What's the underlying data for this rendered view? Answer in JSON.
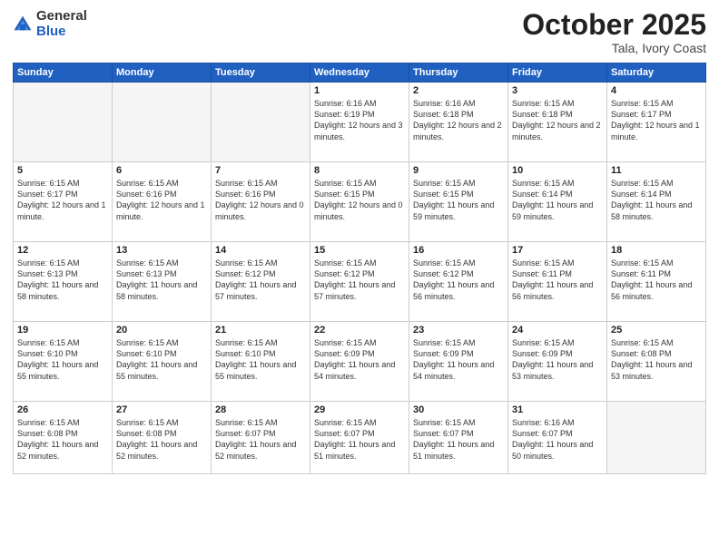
{
  "header": {
    "logo_general": "General",
    "logo_blue": "Blue",
    "month_title": "October 2025",
    "location": "Tala, Ivory Coast"
  },
  "days_of_week": [
    "Sunday",
    "Monday",
    "Tuesday",
    "Wednesday",
    "Thursday",
    "Friday",
    "Saturday"
  ],
  "weeks": [
    [
      {
        "day": "",
        "text": ""
      },
      {
        "day": "",
        "text": ""
      },
      {
        "day": "",
        "text": ""
      },
      {
        "day": "1",
        "text": "Sunrise: 6:16 AM\nSunset: 6:19 PM\nDaylight: 12 hours and 3 minutes."
      },
      {
        "day": "2",
        "text": "Sunrise: 6:16 AM\nSunset: 6:18 PM\nDaylight: 12 hours and 2 minutes."
      },
      {
        "day": "3",
        "text": "Sunrise: 6:15 AM\nSunset: 6:18 PM\nDaylight: 12 hours and 2 minutes."
      },
      {
        "day": "4",
        "text": "Sunrise: 6:15 AM\nSunset: 6:17 PM\nDaylight: 12 hours and 1 minute."
      }
    ],
    [
      {
        "day": "5",
        "text": "Sunrise: 6:15 AM\nSunset: 6:17 PM\nDaylight: 12 hours and 1 minute."
      },
      {
        "day": "6",
        "text": "Sunrise: 6:15 AM\nSunset: 6:16 PM\nDaylight: 12 hours and 1 minute."
      },
      {
        "day": "7",
        "text": "Sunrise: 6:15 AM\nSunset: 6:16 PM\nDaylight: 12 hours and 0 minutes."
      },
      {
        "day": "8",
        "text": "Sunrise: 6:15 AM\nSunset: 6:15 PM\nDaylight: 12 hours and 0 minutes."
      },
      {
        "day": "9",
        "text": "Sunrise: 6:15 AM\nSunset: 6:15 PM\nDaylight: 11 hours and 59 minutes."
      },
      {
        "day": "10",
        "text": "Sunrise: 6:15 AM\nSunset: 6:14 PM\nDaylight: 11 hours and 59 minutes."
      },
      {
        "day": "11",
        "text": "Sunrise: 6:15 AM\nSunset: 6:14 PM\nDaylight: 11 hours and 58 minutes."
      }
    ],
    [
      {
        "day": "12",
        "text": "Sunrise: 6:15 AM\nSunset: 6:13 PM\nDaylight: 11 hours and 58 minutes."
      },
      {
        "day": "13",
        "text": "Sunrise: 6:15 AM\nSunset: 6:13 PM\nDaylight: 11 hours and 58 minutes."
      },
      {
        "day": "14",
        "text": "Sunrise: 6:15 AM\nSunset: 6:12 PM\nDaylight: 11 hours and 57 minutes."
      },
      {
        "day": "15",
        "text": "Sunrise: 6:15 AM\nSunset: 6:12 PM\nDaylight: 11 hours and 57 minutes."
      },
      {
        "day": "16",
        "text": "Sunrise: 6:15 AM\nSunset: 6:12 PM\nDaylight: 11 hours and 56 minutes."
      },
      {
        "day": "17",
        "text": "Sunrise: 6:15 AM\nSunset: 6:11 PM\nDaylight: 11 hours and 56 minutes."
      },
      {
        "day": "18",
        "text": "Sunrise: 6:15 AM\nSunset: 6:11 PM\nDaylight: 11 hours and 56 minutes."
      }
    ],
    [
      {
        "day": "19",
        "text": "Sunrise: 6:15 AM\nSunset: 6:10 PM\nDaylight: 11 hours and 55 minutes."
      },
      {
        "day": "20",
        "text": "Sunrise: 6:15 AM\nSunset: 6:10 PM\nDaylight: 11 hours and 55 minutes."
      },
      {
        "day": "21",
        "text": "Sunrise: 6:15 AM\nSunset: 6:10 PM\nDaylight: 11 hours and 55 minutes."
      },
      {
        "day": "22",
        "text": "Sunrise: 6:15 AM\nSunset: 6:09 PM\nDaylight: 11 hours and 54 minutes."
      },
      {
        "day": "23",
        "text": "Sunrise: 6:15 AM\nSunset: 6:09 PM\nDaylight: 11 hours and 54 minutes."
      },
      {
        "day": "24",
        "text": "Sunrise: 6:15 AM\nSunset: 6:09 PM\nDaylight: 11 hours and 53 minutes."
      },
      {
        "day": "25",
        "text": "Sunrise: 6:15 AM\nSunset: 6:08 PM\nDaylight: 11 hours and 53 minutes."
      }
    ],
    [
      {
        "day": "26",
        "text": "Sunrise: 6:15 AM\nSunset: 6:08 PM\nDaylight: 11 hours and 52 minutes."
      },
      {
        "day": "27",
        "text": "Sunrise: 6:15 AM\nSunset: 6:08 PM\nDaylight: 11 hours and 52 minutes."
      },
      {
        "day": "28",
        "text": "Sunrise: 6:15 AM\nSunset: 6:07 PM\nDaylight: 11 hours and 52 minutes."
      },
      {
        "day": "29",
        "text": "Sunrise: 6:15 AM\nSunset: 6:07 PM\nDaylight: 11 hours and 51 minutes."
      },
      {
        "day": "30",
        "text": "Sunrise: 6:15 AM\nSunset: 6:07 PM\nDaylight: 11 hours and 51 minutes."
      },
      {
        "day": "31",
        "text": "Sunrise: 6:16 AM\nSunset: 6:07 PM\nDaylight: 11 hours and 50 minutes."
      },
      {
        "day": "",
        "text": ""
      }
    ]
  ]
}
